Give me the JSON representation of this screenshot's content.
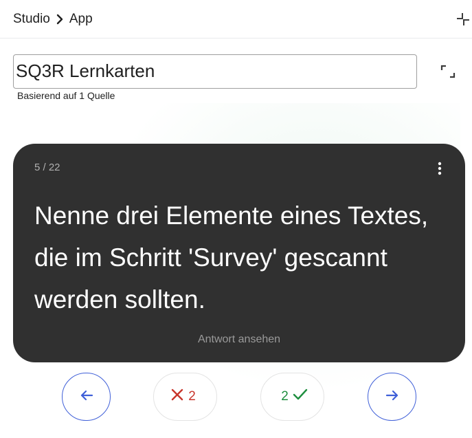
{
  "breadcrumb": {
    "root": "Studio",
    "current": "App"
  },
  "document": {
    "title_value": "SQ3R Lernkarten",
    "source_note": "Basierend auf 1 Quelle"
  },
  "flashcard": {
    "counter": "5 / 22",
    "question": "Nenne drei Elemente eines Textes, die im Schritt 'Survey' gescannt werden sollten.",
    "reveal_label": "Antwort ansehen"
  },
  "controls": {
    "wrong_count": "2",
    "right_count": "2"
  },
  "colors": {
    "card_bg": "#303030",
    "nav_accent": "#3f5fd8",
    "wrong": "#c8352b",
    "right": "#1e8e3e"
  },
  "icons": {
    "separator": "chevron-right-icon",
    "collapse": "collapse-icon",
    "expand": "fullscreen-icon",
    "menu": "more-vert-icon",
    "prev": "arrow-left-icon",
    "next": "arrow-right-icon",
    "wrong": "close-icon",
    "right": "check-icon"
  }
}
